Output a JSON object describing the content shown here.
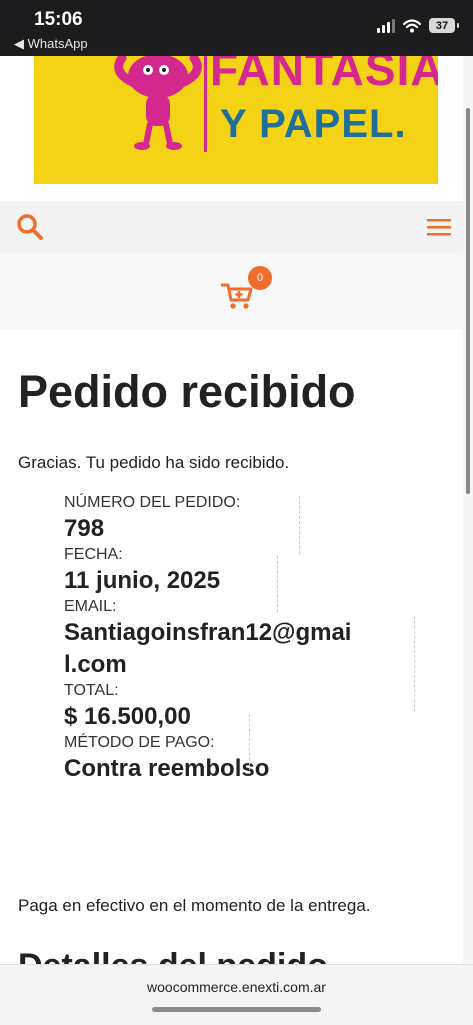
{
  "status_bar": {
    "time": "15:06",
    "back_app": "◀ WhatsApp",
    "battery": "37"
  },
  "logo": {
    "line1": "FANTASIA",
    "line2": "Y PAPEL."
  },
  "nav": {
    "search_icon": "search-icon",
    "menu_icon": "hamburger-menu-icon",
    "cart_icon": "cart-icon",
    "cart_count": "0"
  },
  "colors": {
    "accent": "#f06d2c",
    "logo_yellow": "#f4d316",
    "logo_magenta": "#d5288f",
    "logo_blue": "#1f6f9a"
  },
  "page": {
    "title": "Pedido recibido",
    "thanks": "Gracias. Tu pedido ha sido recibido."
  },
  "order": {
    "number_label": "NÚMERO DEL PEDIDO:",
    "number_value": "798",
    "date_label": "FECHA:",
    "date_value": "11 junio, 2025",
    "email_label": "EMAIL:",
    "email_value_1": "Santiagoinsfran12@gmai",
    "email_value_2": "l.com",
    "total_label": "TOTAL:",
    "total_value": "$ 16.500,00",
    "method_label": "MÉTODO DE PAGO:",
    "method_value": "Contra reembolso"
  },
  "payment_note": "Paga en efectivo en el momento de la entrega.",
  "next_heading": "Detalles del pedido",
  "browser": {
    "domain": "woocommerce.enexti.com.ar"
  }
}
